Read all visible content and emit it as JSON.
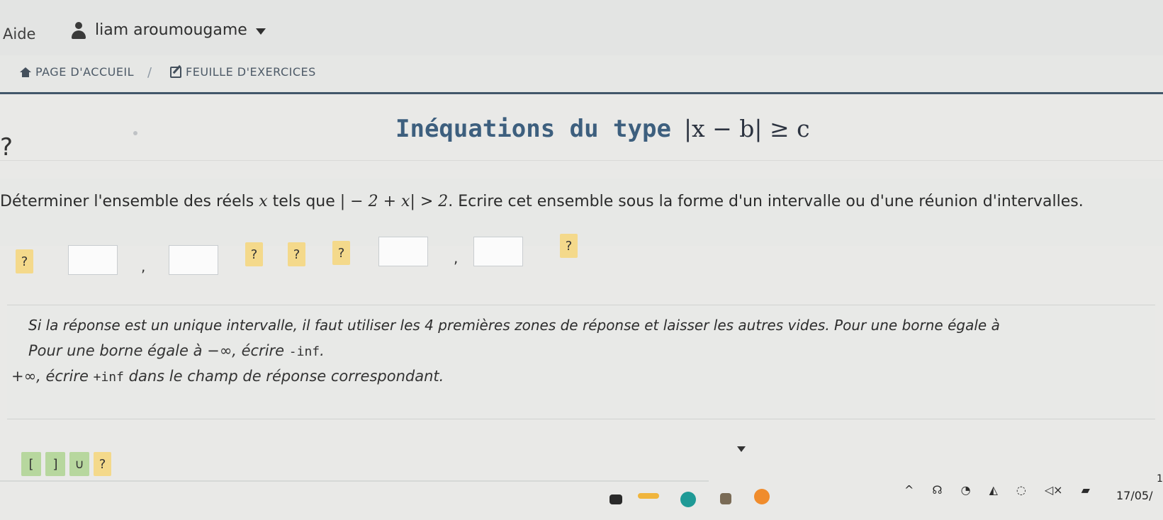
{
  "topbar": {
    "help_label": "Aide",
    "user_name": "liam aroumougame"
  },
  "breadcrumb": {
    "home_label": "PAGE D'ACCUEIL",
    "separator": "/",
    "exercises_label": "FEUILLE D'EXERCICES"
  },
  "page": {
    "title_text": "Inéquations du type",
    "title_math": "|x − b| ≥ c"
  },
  "question": {
    "prefix": "Déterminer l'ensemble des réels",
    "var": "x",
    "middle": "tels que",
    "inequality": "| − 2 + x| > 2",
    "suffix": ". Ecrire cet ensemble sous la forme d'un intervalle ou d'une réunion d'intervalles."
  },
  "answer": {
    "placeholder": "?",
    "comma": ","
  },
  "info": {
    "line1_part1": "Si la réponse est un unique intervalle, il faut utiliser les 4 premières zones de réponse et laisser les autres vides. Pour une borne égale à",
    "line2_part1": "Pour une borne égale à −∞, écrire ",
    "line2_code": "-inf",
    "line2_end": ".",
    "line3_part1": "+∞, écrire ",
    "line3_code": "+inf",
    "line3_part2": " dans le champ de réponse correspondant."
  },
  "symbols": [
    "[",
    "]",
    "∪",
    "?"
  ],
  "taskbar": {
    "date_fragment": "17/05/",
    "time_fragment": "1"
  },
  "colors": {
    "title": "#3d5f7e",
    "question_button": "#f4d98b",
    "symbol_button": "#b7d79e",
    "rule": "#42576a"
  }
}
